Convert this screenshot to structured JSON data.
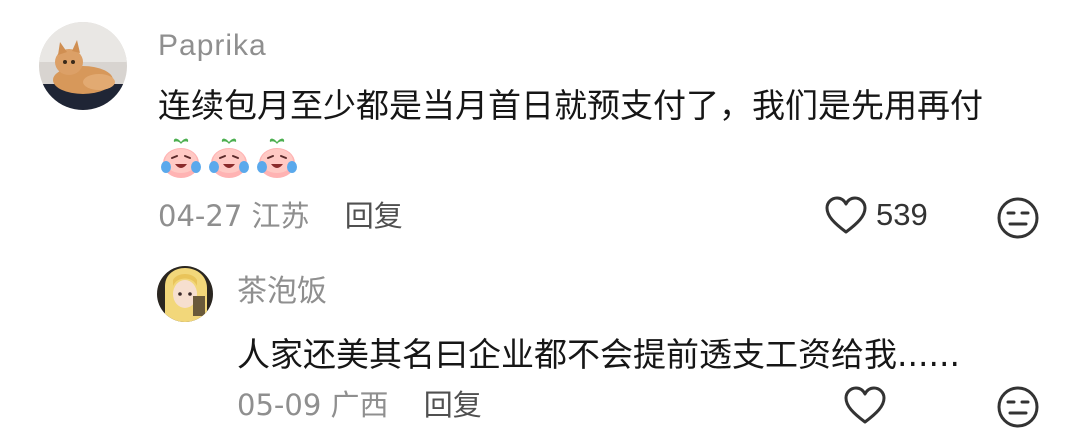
{
  "comments": [
    {
      "username": "Paprika",
      "text": "连续包月至少都是当月首日就预支付了，我们是先用再付",
      "emojis": [
        "crying-laughing-peach-icon",
        "crying-laughing-peach-icon",
        "crying-laughing-peach-icon"
      ],
      "date": "04-27",
      "location": "江苏",
      "reply_label": "回复",
      "likes": "539"
    },
    {
      "username": "茶泡饭",
      "text": "人家还美其名曰企业都不会提前透支工资给我......",
      "date": "05-09",
      "location": "广西",
      "reply_label": "回复",
      "likes": ""
    }
  ],
  "colors": {
    "meta": "#8f8f8f",
    "text": "#161616",
    "reply": "#505050"
  }
}
